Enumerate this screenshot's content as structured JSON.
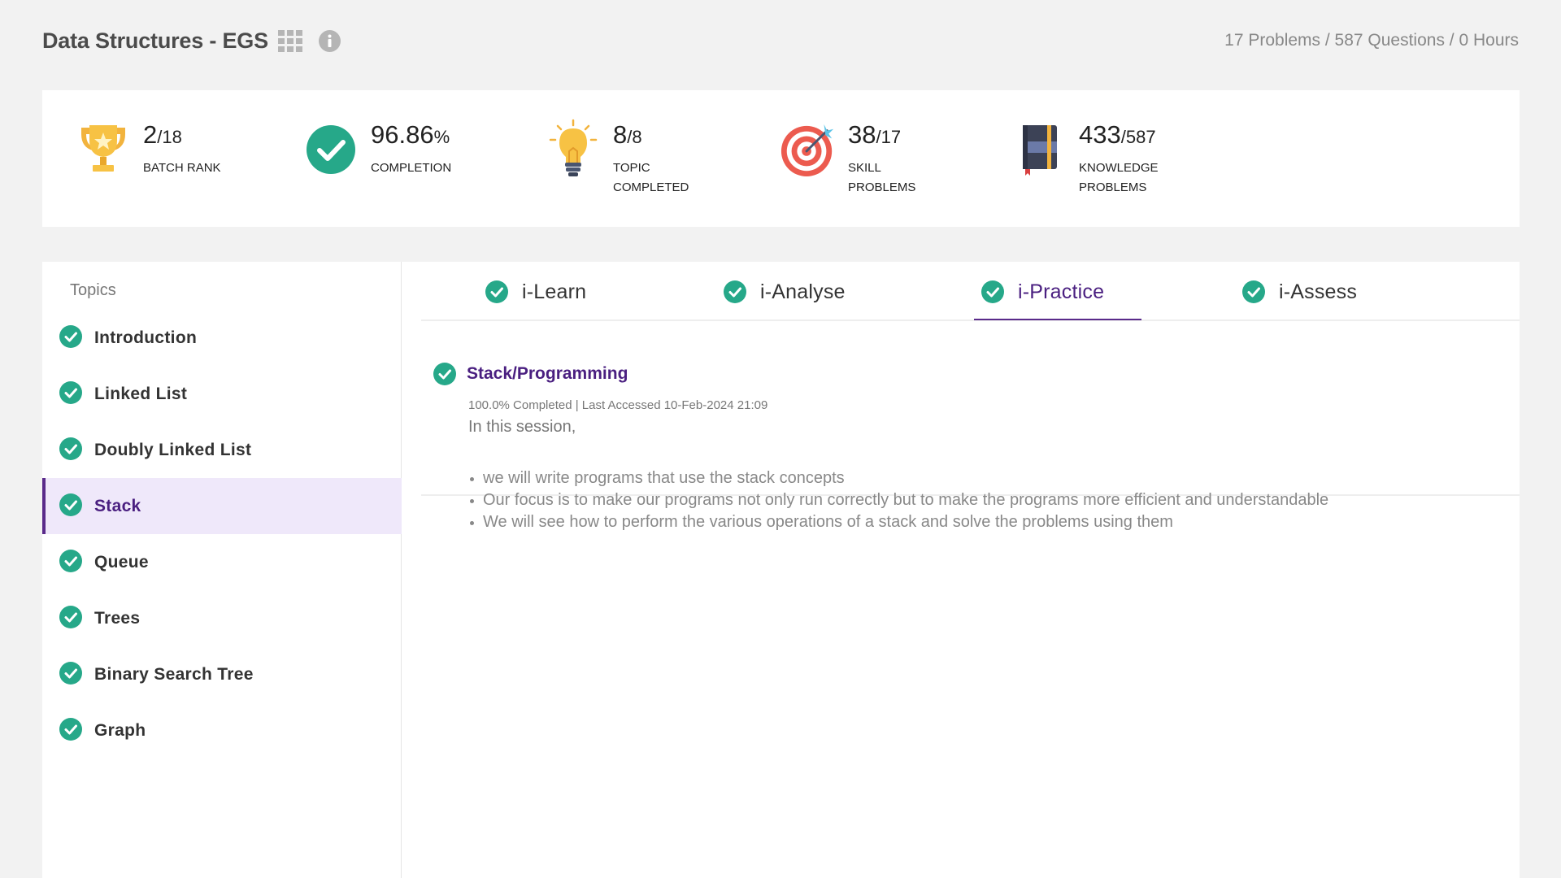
{
  "header": {
    "course_title": "Data Structures - EGS",
    "summary": "17 Problems / 587 Questions / 0 Hours"
  },
  "stats": {
    "batch_rank": {
      "value": "2",
      "total": "/18",
      "label": "BATCH RANK"
    },
    "completion": {
      "value": "96.86",
      "unit": "%",
      "label": "COMPLETION"
    },
    "topic_completed": {
      "value": "8",
      "total": "/8",
      "label": "TOPIC COMPLETED"
    },
    "skill_problems": {
      "value": "38",
      "total": "/17",
      "label": "SKILL PROBLEMS"
    },
    "knowledge_problems": {
      "value": "433",
      "total": "/587",
      "label": "KNOWLEDGE PROBLEMS"
    }
  },
  "sidebar": {
    "heading": "Topics",
    "items": [
      {
        "label": "Introduction"
      },
      {
        "label": "Linked List"
      },
      {
        "label": "Doubly Linked List"
      },
      {
        "label": "Stack"
      },
      {
        "label": "Queue"
      },
      {
        "label": "Trees"
      },
      {
        "label": "Binary Search Tree"
      },
      {
        "label": "Graph"
      }
    ],
    "active_index": 3
  },
  "tabs": [
    {
      "label": "i-Learn"
    },
    {
      "label": "i-Analyse"
    },
    {
      "label": "i-Practice"
    },
    {
      "label": "i-Assess"
    }
  ],
  "active_tab": "i-Practice",
  "session": {
    "title": "Stack/Programming",
    "meta": "100.0% Completed | Last Accessed 10-Feb-2024 21:09",
    "intro": "In this session,",
    "bullets": [
      "we will write programs that use the stack concepts",
      "Our focus is to make our programs not only run correctly but to make the programs more efficient and understandable",
      "We will see how to perform the various operations of a stack and solve the problems using them"
    ]
  },
  "colors": {
    "check_green": "#26a889",
    "accent_purple": "#4a1f80",
    "active_bg": "#efe8fa"
  }
}
